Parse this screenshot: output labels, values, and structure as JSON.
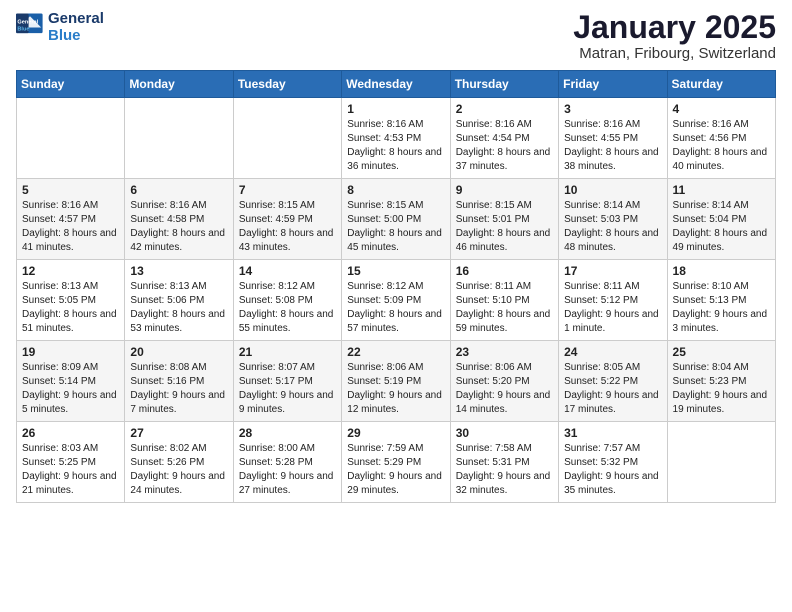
{
  "header": {
    "logo_line1": "General",
    "logo_line2": "Blue",
    "month": "January 2025",
    "location": "Matran, Fribourg, Switzerland"
  },
  "days_of_week": [
    "Sunday",
    "Monday",
    "Tuesday",
    "Wednesday",
    "Thursday",
    "Friday",
    "Saturday"
  ],
  "weeks": [
    [
      {
        "day": "",
        "info": ""
      },
      {
        "day": "",
        "info": ""
      },
      {
        "day": "",
        "info": ""
      },
      {
        "day": "1",
        "info": "Sunrise: 8:16 AM\nSunset: 4:53 PM\nDaylight: 8 hours and 36 minutes."
      },
      {
        "day": "2",
        "info": "Sunrise: 8:16 AM\nSunset: 4:54 PM\nDaylight: 8 hours and 37 minutes."
      },
      {
        "day": "3",
        "info": "Sunrise: 8:16 AM\nSunset: 4:55 PM\nDaylight: 8 hours and 38 minutes."
      },
      {
        "day": "4",
        "info": "Sunrise: 8:16 AM\nSunset: 4:56 PM\nDaylight: 8 hours and 40 minutes."
      }
    ],
    [
      {
        "day": "5",
        "info": "Sunrise: 8:16 AM\nSunset: 4:57 PM\nDaylight: 8 hours and 41 minutes."
      },
      {
        "day": "6",
        "info": "Sunrise: 8:16 AM\nSunset: 4:58 PM\nDaylight: 8 hours and 42 minutes."
      },
      {
        "day": "7",
        "info": "Sunrise: 8:15 AM\nSunset: 4:59 PM\nDaylight: 8 hours and 43 minutes."
      },
      {
        "day": "8",
        "info": "Sunrise: 8:15 AM\nSunset: 5:00 PM\nDaylight: 8 hours and 45 minutes."
      },
      {
        "day": "9",
        "info": "Sunrise: 8:15 AM\nSunset: 5:01 PM\nDaylight: 8 hours and 46 minutes."
      },
      {
        "day": "10",
        "info": "Sunrise: 8:14 AM\nSunset: 5:03 PM\nDaylight: 8 hours and 48 minutes."
      },
      {
        "day": "11",
        "info": "Sunrise: 8:14 AM\nSunset: 5:04 PM\nDaylight: 8 hours and 49 minutes."
      }
    ],
    [
      {
        "day": "12",
        "info": "Sunrise: 8:13 AM\nSunset: 5:05 PM\nDaylight: 8 hours and 51 minutes."
      },
      {
        "day": "13",
        "info": "Sunrise: 8:13 AM\nSunset: 5:06 PM\nDaylight: 8 hours and 53 minutes."
      },
      {
        "day": "14",
        "info": "Sunrise: 8:12 AM\nSunset: 5:08 PM\nDaylight: 8 hours and 55 minutes."
      },
      {
        "day": "15",
        "info": "Sunrise: 8:12 AM\nSunset: 5:09 PM\nDaylight: 8 hours and 57 minutes."
      },
      {
        "day": "16",
        "info": "Sunrise: 8:11 AM\nSunset: 5:10 PM\nDaylight: 8 hours and 59 minutes."
      },
      {
        "day": "17",
        "info": "Sunrise: 8:11 AM\nSunset: 5:12 PM\nDaylight: 9 hours and 1 minute."
      },
      {
        "day": "18",
        "info": "Sunrise: 8:10 AM\nSunset: 5:13 PM\nDaylight: 9 hours and 3 minutes."
      }
    ],
    [
      {
        "day": "19",
        "info": "Sunrise: 8:09 AM\nSunset: 5:14 PM\nDaylight: 9 hours and 5 minutes."
      },
      {
        "day": "20",
        "info": "Sunrise: 8:08 AM\nSunset: 5:16 PM\nDaylight: 9 hours and 7 minutes."
      },
      {
        "day": "21",
        "info": "Sunrise: 8:07 AM\nSunset: 5:17 PM\nDaylight: 9 hours and 9 minutes."
      },
      {
        "day": "22",
        "info": "Sunrise: 8:06 AM\nSunset: 5:19 PM\nDaylight: 9 hours and 12 minutes."
      },
      {
        "day": "23",
        "info": "Sunrise: 8:06 AM\nSunset: 5:20 PM\nDaylight: 9 hours and 14 minutes."
      },
      {
        "day": "24",
        "info": "Sunrise: 8:05 AM\nSunset: 5:22 PM\nDaylight: 9 hours and 17 minutes."
      },
      {
        "day": "25",
        "info": "Sunrise: 8:04 AM\nSunset: 5:23 PM\nDaylight: 9 hours and 19 minutes."
      }
    ],
    [
      {
        "day": "26",
        "info": "Sunrise: 8:03 AM\nSunset: 5:25 PM\nDaylight: 9 hours and 21 minutes."
      },
      {
        "day": "27",
        "info": "Sunrise: 8:02 AM\nSunset: 5:26 PM\nDaylight: 9 hours and 24 minutes."
      },
      {
        "day": "28",
        "info": "Sunrise: 8:00 AM\nSunset: 5:28 PM\nDaylight: 9 hours and 27 minutes."
      },
      {
        "day": "29",
        "info": "Sunrise: 7:59 AM\nSunset: 5:29 PM\nDaylight: 9 hours and 29 minutes."
      },
      {
        "day": "30",
        "info": "Sunrise: 7:58 AM\nSunset: 5:31 PM\nDaylight: 9 hours and 32 minutes."
      },
      {
        "day": "31",
        "info": "Sunrise: 7:57 AM\nSunset: 5:32 PM\nDaylight: 9 hours and 35 minutes."
      },
      {
        "day": "",
        "info": ""
      }
    ]
  ]
}
